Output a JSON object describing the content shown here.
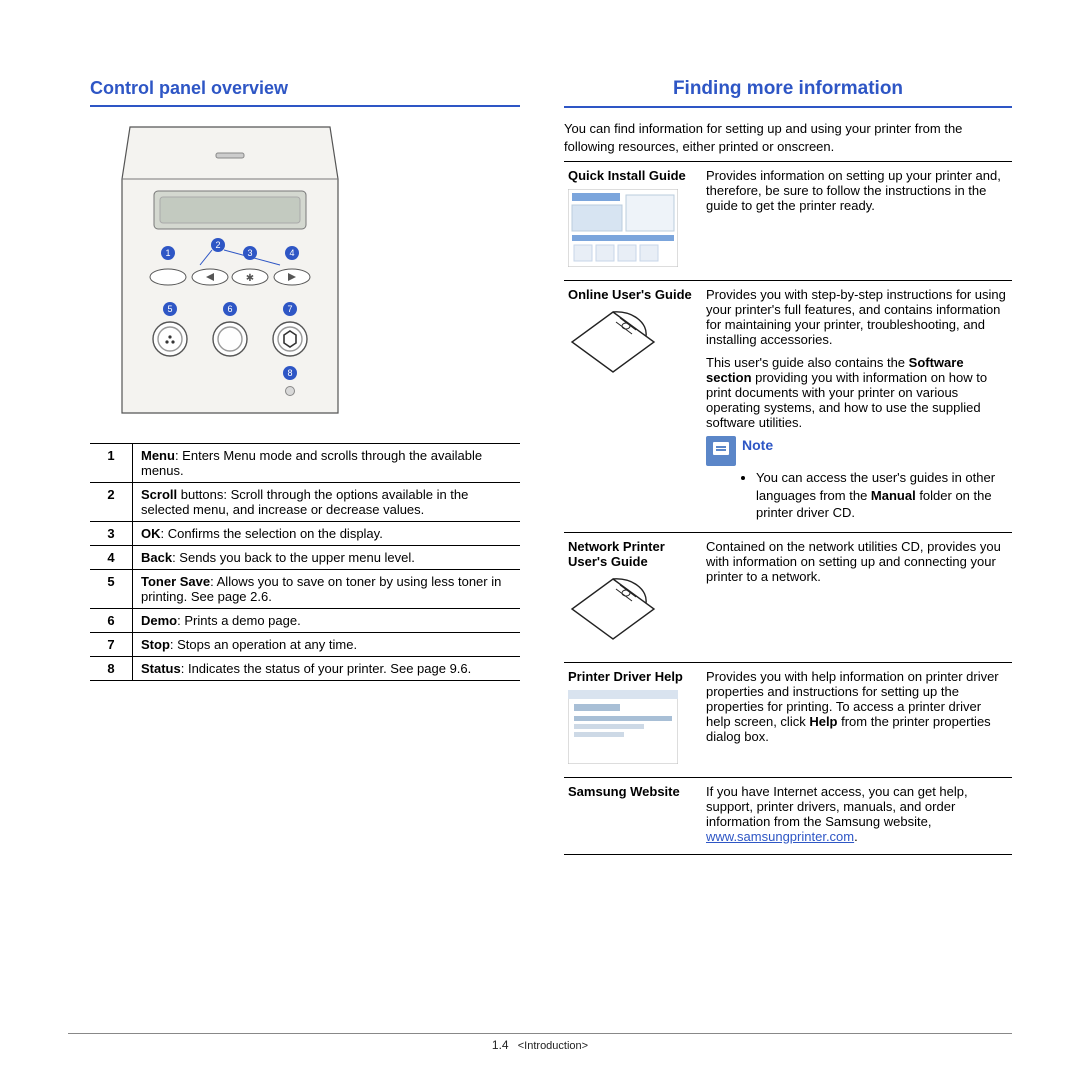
{
  "left": {
    "heading": "Control panel overview",
    "callouts": [
      "1",
      "2",
      "3",
      "4",
      "5",
      "6",
      "7",
      "8"
    ],
    "defs": [
      {
        "n": "1",
        "term": "Menu",
        "text": ": Enters Menu mode and scrolls through the available menus."
      },
      {
        "n": "2",
        "term": "Scroll",
        "text": " buttons: Scroll through the options available in the selected menu, and increase or decrease values."
      },
      {
        "n": "3",
        "term": "OK",
        "text": ": Confirms the selection on the display."
      },
      {
        "n": "4",
        "term": "Back",
        "text": ": Sends you back to the upper menu level."
      },
      {
        "n": "5",
        "term": "Toner Save",
        "text": ": Allows you to save on toner by using less toner in printing. See page 2.6."
      },
      {
        "n": "6",
        "term": "Demo",
        "text": ": Prints a demo page."
      },
      {
        "n": "7",
        "term": "Stop",
        "text": ": Stops an operation at any time."
      },
      {
        "n": "8",
        "term": "Status",
        "text": ": Indicates the status of your printer. See page 9.6."
      }
    ]
  },
  "right": {
    "heading": "Finding more information",
    "intro": "You can find information for setting up and using your printer from the following resources, either printed or onscreen.",
    "rows": [
      {
        "title": "Quick Install Guide",
        "thumb": "qig",
        "paras": [
          {
            "plain": "Provides information on setting up your printer and, therefore, be sure to follow the instructions in the guide to get the printer ready."
          }
        ]
      },
      {
        "title": "Online User's Guide",
        "thumb": "cd",
        "paras": [
          {
            "plain": "Provides you with step-by-step instructions for using your printer's full features, and contains information for maintaining your printer, troubleshooting, and installing accessories."
          },
          {
            "pre": "This user's guide also contains the ",
            "bold": "Software section",
            "post": " providing you with information on how to print documents with your printer on various operating systems, and how to use the supplied software utilities."
          }
        ],
        "note": {
          "label": "Note",
          "bullet_pre": "You can access the user's guides in other languages from the ",
          "bullet_bold": "Manual",
          "bullet_post": " folder on the printer driver CD."
        }
      },
      {
        "title": "Network Printer User's Guide",
        "thumb": "cd",
        "paras": [
          {
            "plain": "Contained on the network utilities CD, provides you with information on setting up and connecting your printer to a network."
          }
        ]
      },
      {
        "title": "Printer Driver Help",
        "thumb": "dlg",
        "paras": [
          {
            "pre": "Provides you with help information on printer driver properties and instructions for setting up the properties for printing. To access a printer driver help screen, click ",
            "bold": "Help",
            "post": " from the printer properties dialog box."
          }
        ]
      },
      {
        "title": "Samsung Website",
        "thumb": "",
        "paras": [
          {
            "plain": "If you have Internet access, you can get help, support, printer drivers, manuals, and order information from the Samsung website, "
          }
        ],
        "link": "www.samsungprinter.com"
      }
    ]
  },
  "footer": {
    "page": "1.4",
    "chapter": "<Introduction>"
  }
}
